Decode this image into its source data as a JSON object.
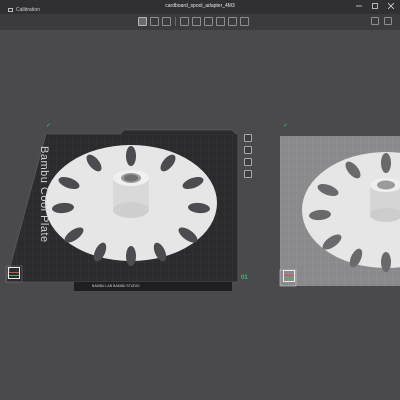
{
  "app": {
    "title": "cardboard_spool_adapter_4M3",
    "calibration_label": "Calibration"
  },
  "toolbar": {
    "buttons": [
      "home-icon",
      "cube-view-icon",
      "layers-icon",
      "grid-icon",
      "ruler-icon",
      "move-icon",
      "rotate-icon",
      "scale-icon",
      "support-icon"
    ],
    "right_buttons": [
      "settings-icon",
      "menu-icon"
    ]
  },
  "plates": [
    {
      "label": "Bambu Cool Plate",
      "number": "01",
      "footer": "BAMBU LAB  BAMBU STUDIO",
      "selected": true
    },
    {
      "label": "",
      "number": "",
      "selected": false
    }
  ],
  "plate_side_icons": [
    "arrange-icon",
    "orient-icon",
    "lock-icon",
    "settings-icon"
  ],
  "colors": {
    "accent": "#33c06a",
    "plate_dark": "#2b2b2e",
    "plate_light": "#8a8a8d",
    "model": "#e6e6e6"
  }
}
